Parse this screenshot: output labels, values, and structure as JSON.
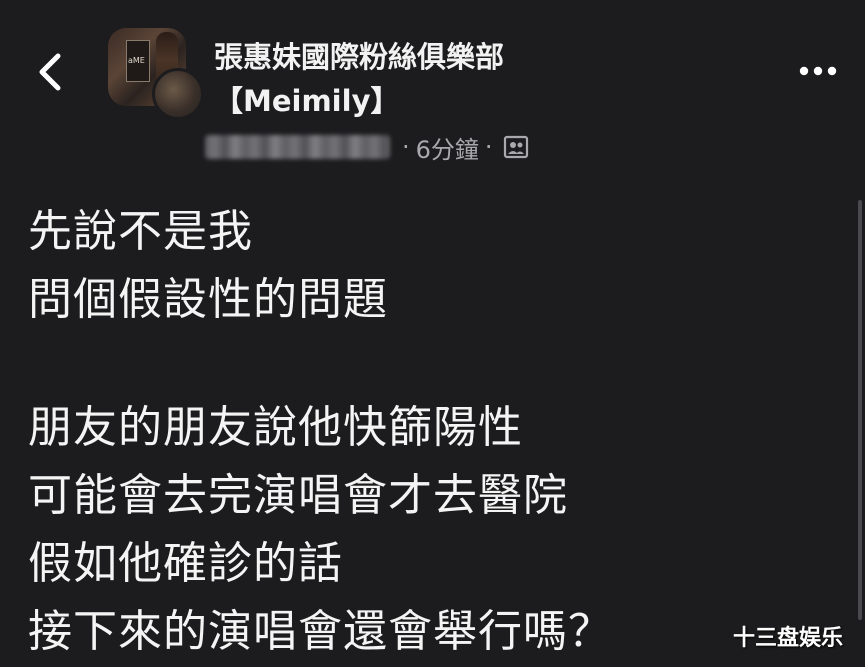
{
  "header": {
    "back_icon": "chevron-left-icon",
    "group_name_line1": "張惠妹國際粉絲俱樂部",
    "group_name_line2": "【Meimily】",
    "avatar_overlay_text": "aME",
    "timestamp": "6分鐘",
    "meta_separator": "·",
    "audience_icon": "group-icon",
    "more_icon": "more-horizontal-icon"
  },
  "post": {
    "lines": [
      "先說不是我",
      "問個假設性的問題",
      "",
      "朋友的朋友說他快篩陽性",
      "可能會去完演唱會才去醫院",
      "假如他確診的話",
      "接下來的演唱會還會舉行嗎？"
    ]
  },
  "watermark": "十三盘娱乐",
  "colors": {
    "background": "#1c1c1e",
    "text": "#f4f4f4",
    "meta_text": "#a8a8ad"
  }
}
